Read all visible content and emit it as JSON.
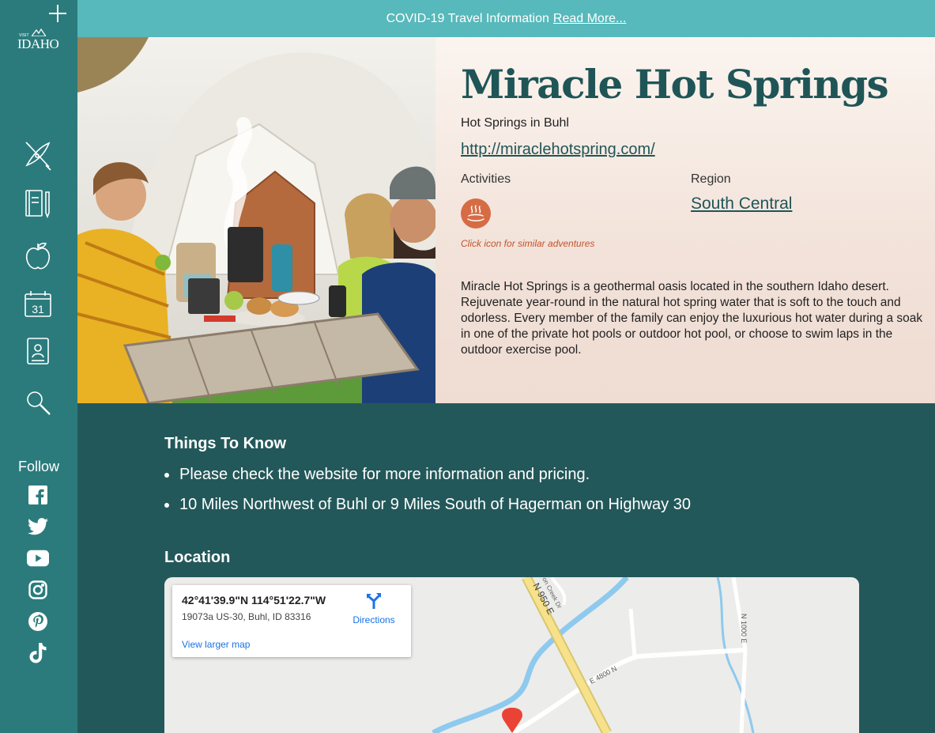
{
  "banner": {
    "text": "COVID-19 Travel Information",
    "link": "Read More..."
  },
  "sidebar": {
    "logo_small": "VISIT",
    "logo_text": "IDAHO",
    "nav": [
      {
        "icon": "kayak-icon"
      },
      {
        "icon": "notebook-icon"
      },
      {
        "icon": "apple-icon"
      },
      {
        "icon": "calendar-icon",
        "text": "31"
      },
      {
        "icon": "passport-icon"
      },
      {
        "icon": "search-icon"
      }
    ],
    "follow_label": "Follow",
    "social": [
      "facebook-icon",
      "twitter-icon",
      "youtube-icon",
      "instagram-icon",
      "pinterest-icon",
      "tiktok-icon"
    ]
  },
  "hero": {
    "title": "Miracle Hot Springs",
    "subtitle": "Hot Springs in Buhl",
    "website": "http://miraclehotspring.com/",
    "activities_label": "Activities",
    "activity_icon": "hot-springs-icon",
    "activity_hint": "Click icon for similar adventures",
    "region_label": "Region",
    "region": "South Central",
    "description": "Miracle Hot Springs is a geothermal oasis located in the southern Idaho desert. Rejuvenate year-round in the natural hot spring water that is soft to the touch and odorless. Every member of the family can enjoy the luxurious hot water during a soak in one of the private hot pools or outdoor hot pool, or choose to swim laps in the outdoor exercise pool."
  },
  "things_to_know": {
    "heading": "Things To Know",
    "items": [
      "Please check the website for more information and pricing.",
      "10 Miles Northwest of Buhl or 9 Miles South of Hagerman on Highway 30"
    ]
  },
  "location": {
    "heading": "Location",
    "coords": "42°41'39.9\"N 114°51'22.7\"W",
    "address": "19073a US-30, Buhl, ID 83316",
    "directions": "Directions",
    "larger_map": "View larger map",
    "roads": [
      "N 950 E",
      "E 4800 N",
      "N 1000 E",
      "on Creek Dr"
    ]
  },
  "colors": {
    "sidebar": "#2b7b7d",
    "banner": "#57b9bb",
    "dark_teal": "#23585a",
    "title": "#1f5557",
    "accent_orange": "#d66c44"
  }
}
